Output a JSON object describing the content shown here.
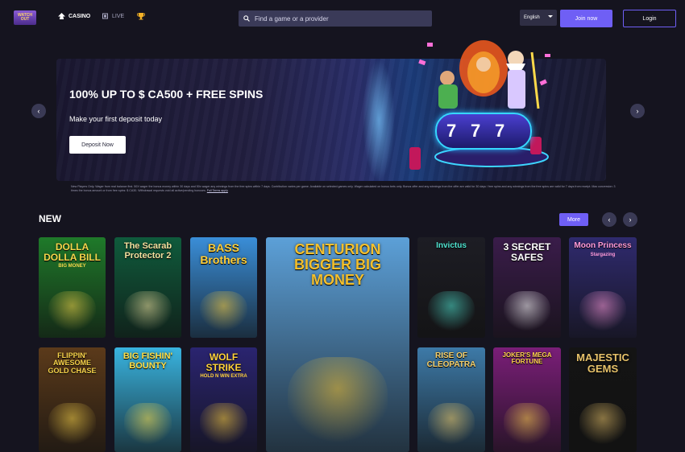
{
  "header": {
    "logo_text": "WATCH OUT",
    "nav": [
      {
        "label": "CASINO",
        "icon": "spade-icon"
      },
      {
        "label": "LIVE",
        "icon": "live-icon"
      },
      {
        "label": "",
        "icon": "trophy-icon"
      }
    ],
    "search_placeholder": "Find a game or a provider",
    "language": "English",
    "join_label": "Join now",
    "login_label": "Login"
  },
  "banner": {
    "title": "100% UP TO $ CA500 + FREE SPINS",
    "subtitle": "Make your first deposit today",
    "cta_label": "Deposit Now",
    "slot_digits": [
      "7",
      "7",
      "7"
    ]
  },
  "terms": {
    "text": "New Players Only. Wager from real balance first. 50X wager the bonus money within 30 days and 50x wager any winnings from the free spins within 7 days. Contribution varies per game. Available on selected games only. Wager calculated on bonus bets only. Bonus offer and any winnings from the offer are valid for 30 days / free spins and any winnings from the free spins are valid for 7 days from receipt. Max conversion: 3 times the bonus amount or from free spins: $ CA30. Withdrawal requests void all active/pending bonuses.",
    "link_label": "Full Terms apply"
  },
  "section": {
    "title": "NEW",
    "more_label": "More"
  },
  "games": [
    {
      "title": "DOLLA DOLLA BILL",
      "subtitle": "BIG MONEY",
      "color": "#1f7a2a",
      "accent": "#f6d64b"
    },
    {
      "title": "The Scarab Protector 2",
      "subtitle": "",
      "color": "#0f5b3c",
      "accent": "#f3e2a0"
    },
    {
      "title": "BASS Brothers",
      "subtitle": "",
      "color": "#3a8ed8",
      "accent": "#ffcf3a"
    },
    {
      "title": "CENTURION BIGGER BIG MONEY",
      "subtitle": "",
      "color": "#5ca0d8",
      "accent": "#f3c02e"
    },
    {
      "title": "Invictus",
      "subtitle": "",
      "color": "#1d1d24",
      "accent": "#4fe3d0"
    },
    {
      "title": "3 SECRET SAFES",
      "subtitle": "",
      "color": "#3a1c4a",
      "accent": "#ffffff"
    },
    {
      "title": "Moon Princess",
      "subtitle": "Stargazing",
      "color": "#2f2a6e",
      "accent": "#ff9ad8"
    },
    {
      "title": "FLIPPIN' AWESOME GOLD CHASE",
      "subtitle": "",
      "color": "#5b3a1a",
      "accent": "#f7d34a"
    },
    {
      "title": "BIG FISHIN' BOUNTY",
      "subtitle": "",
      "color": "#39b4e0",
      "accent": "#ffe04a"
    },
    {
      "title": "WOLF STRIKE",
      "subtitle": "HOLD N WIN EXTRA",
      "color": "#2a2470",
      "accent": "#ffd23a"
    },
    {
      "title": "RISE OF CLEOPATRA",
      "subtitle": "",
      "color": "#3d7aa8",
      "accent": "#f5cf6a"
    },
    {
      "title": "JOKER'S MEGA FORTUNE",
      "subtitle": "",
      "color": "#7a1e78",
      "accent": "#ffd34d"
    },
    {
      "title": "MAJESTIC GEMS",
      "subtitle": "",
      "color": "#141414",
      "accent": "#e7c26a"
    }
  ]
}
